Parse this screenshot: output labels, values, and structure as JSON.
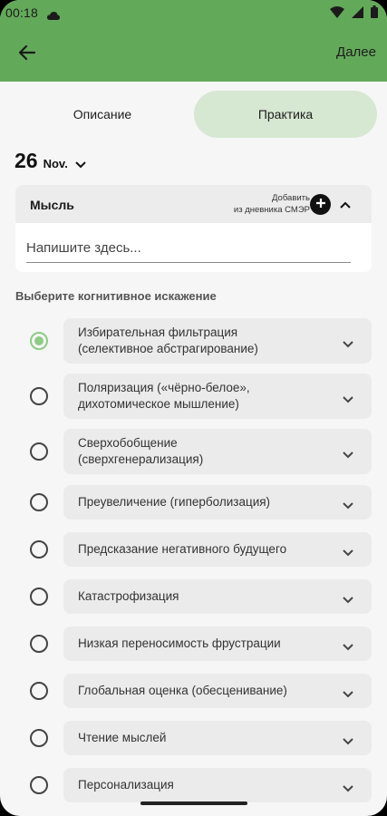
{
  "status_bar": {
    "time": "00:18"
  },
  "app_bar": {
    "back_icon": "arrow-left-icon",
    "next_label": "Далее"
  },
  "tabs": [
    {
      "label": "Описание",
      "active": false
    },
    {
      "label": "Практика",
      "active": true
    }
  ],
  "date": {
    "day": "26",
    "month": "Nov."
  },
  "thought": {
    "title": "Мысль",
    "add_line1": "Добавить",
    "add_line2": "из дневника СМЭР",
    "placeholder": "Напишите здесь..."
  },
  "section_label": "Выберите когнитивное искажение",
  "distortions": [
    {
      "line1": "Избирательная фильтрация",
      "line2": "(селективное абстрагирование)",
      "selected": true
    },
    {
      "line1": "Поляризация («чёрно-белое»,",
      "line2": "дихотомическое мышление)",
      "selected": false
    },
    {
      "line1": "Сверхобобщение",
      "line2": "(сверхгенерализация)",
      "selected": false
    },
    {
      "line1": "Преувеличение (гиперболизация)",
      "line2": "",
      "selected": false
    },
    {
      "line1": "Предсказание негативного будущего",
      "line2": "",
      "selected": false
    },
    {
      "line1": "Катастрофизация",
      "line2": "",
      "selected": false
    },
    {
      "line1": "Низкая переносимость фрустрации",
      "line2": "",
      "selected": false
    },
    {
      "line1": "Глобальная оценка (обесценивание)",
      "line2": "",
      "selected": false
    },
    {
      "line1": "Чтение мыслей",
      "line2": "",
      "selected": false
    },
    {
      "line1": "Персонализация",
      "line2": "",
      "selected": false
    }
  ],
  "colors": {
    "app_bar": "#63a95a",
    "active_tab": "#d6e7d2",
    "radio_selected": "#8ecb86"
  }
}
